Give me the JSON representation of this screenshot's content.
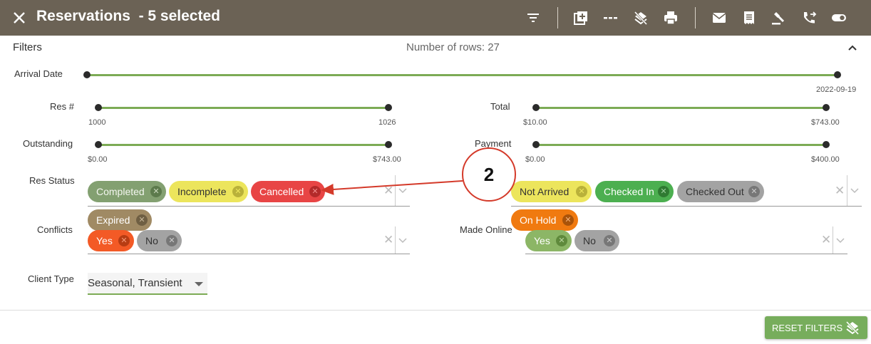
{
  "header": {
    "title": "Reservations  - 5 selected",
    "bg_color": "#6b6255",
    "toolbar_icons": [
      "filter-icon",
      "add-icon",
      "divider-icon",
      "layers-off-icon",
      "print-icon",
      "email-icon",
      "receipt-icon",
      "gavel-icon",
      "phone-forward-icon",
      "toggle-icon"
    ]
  },
  "filters": {
    "label": "Filters",
    "rows_count": "Number of rows: 27",
    "arrival_date": {
      "label": "Arrival Date",
      "max": "2022-09-19"
    },
    "res_num": {
      "label": "Res #",
      "min": "1000",
      "max": "1026"
    },
    "total": {
      "label": "Total",
      "min": "$10.00",
      "max": "$743.00"
    },
    "outstanding": {
      "label": "Outstanding",
      "min": "$0.00",
      "max": "$743.00"
    },
    "payment": {
      "label": "Payment",
      "min": "$0.00",
      "max": "$400.00"
    },
    "res_status": {
      "label": "Res Status",
      "chips": [
        "Completed",
        "Incomplete",
        "Cancelled",
        "Not Arrived",
        "Checked In",
        "Checked Out",
        "Expired",
        "On Hold"
      ]
    },
    "conflicts": {
      "label": "Conflicts",
      "chips": [
        "Yes",
        "No"
      ]
    },
    "made_online": {
      "label": "Made Online",
      "chips": [
        "Yes",
        "No"
      ]
    },
    "client_type": {
      "label": "Client Type",
      "value": "Seasonal, Transient"
    },
    "reset_label": "RESET FILTERS"
  },
  "annotation": {
    "number": "2",
    "color": "#d43a2a"
  },
  "colors": {
    "accent_green": "#7cab55",
    "cancelled_red": "#e84545"
  }
}
